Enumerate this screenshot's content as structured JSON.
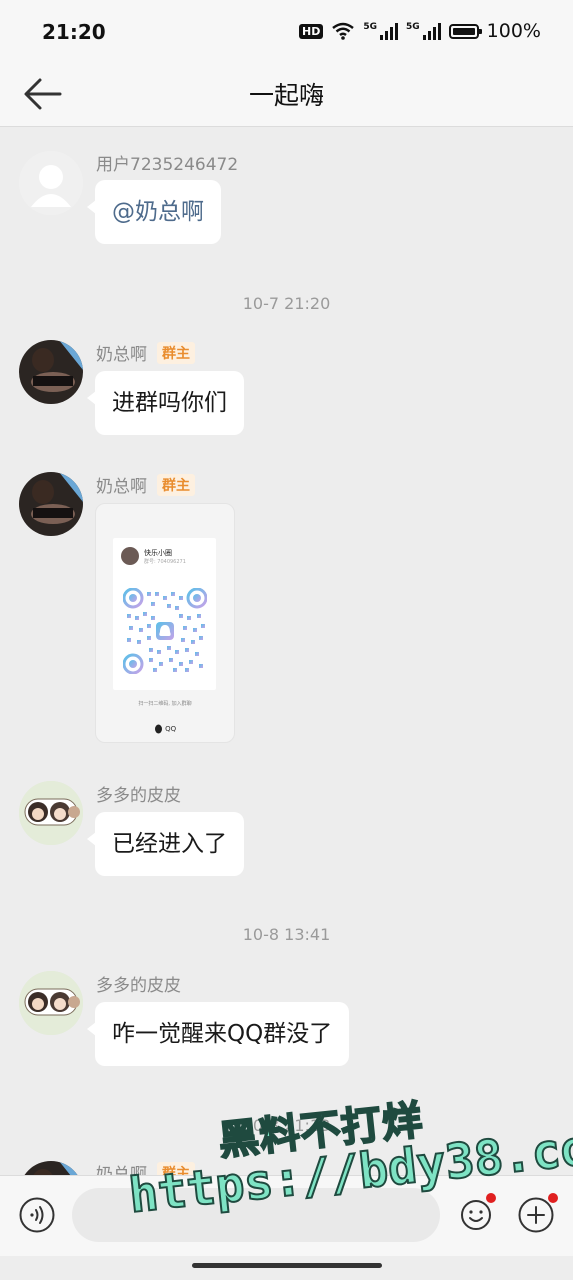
{
  "status_bar": {
    "time": "21:20",
    "hd": "HD",
    "signal1": "5G",
    "signal2": "5G",
    "battery_level": 1.0,
    "battery_text": "100%"
  },
  "header": {
    "title": "一起嗨",
    "back_icon": "arrow-left-icon"
  },
  "messages": [
    {
      "sender": "用户7235246472",
      "badge": "",
      "text": "@奶总啊",
      "avatar": "default-avatar"
    },
    {
      "timestamp": "10-7 21:20"
    },
    {
      "sender": "奶总啊",
      "badge": "群主",
      "text": "进群吗你们",
      "avatar": "photo-avatar"
    },
    {
      "sender": "奶总啊",
      "badge": "群主",
      "type": "qr-card",
      "avatar": "photo-avatar",
      "card": {
        "name": "快乐小圈",
        "sub": "群号: 704096271",
        "caption": "扫一扫二维码, 加入群聊",
        "logo": "QQ"
      }
    },
    {
      "sender": "多多的皮皮",
      "badge": "",
      "text": "已经进入了",
      "avatar": "anime-avatar"
    },
    {
      "timestamp": "10-8 13:41"
    },
    {
      "sender": "多多的皮皮",
      "badge": "",
      "text": "咋一觉醒来QQ群没了",
      "avatar": "anime-avatar"
    },
    {
      "timestamp": "10-8 21:13"
    },
    {
      "sender": "奶总啊",
      "badge": "群主",
      "text": "",
      "avatar": "photo-avatar"
    }
  ],
  "input_bar": {
    "voice_icon": "voice-icon",
    "placeholder": "",
    "emoji_icon": "emoji-icon",
    "plus_icon": "plus-icon"
  },
  "watermark": {
    "line1": "黑料不打烊",
    "line2": "https://bdy38.co"
  },
  "colors": {
    "background": "#ededed",
    "bubble": "#ffffff",
    "badge_text": "#e98d2f",
    "badge_bg": "#fdf0e0",
    "mention": "#4e6b8c",
    "notify_dot": "#e02020"
  }
}
